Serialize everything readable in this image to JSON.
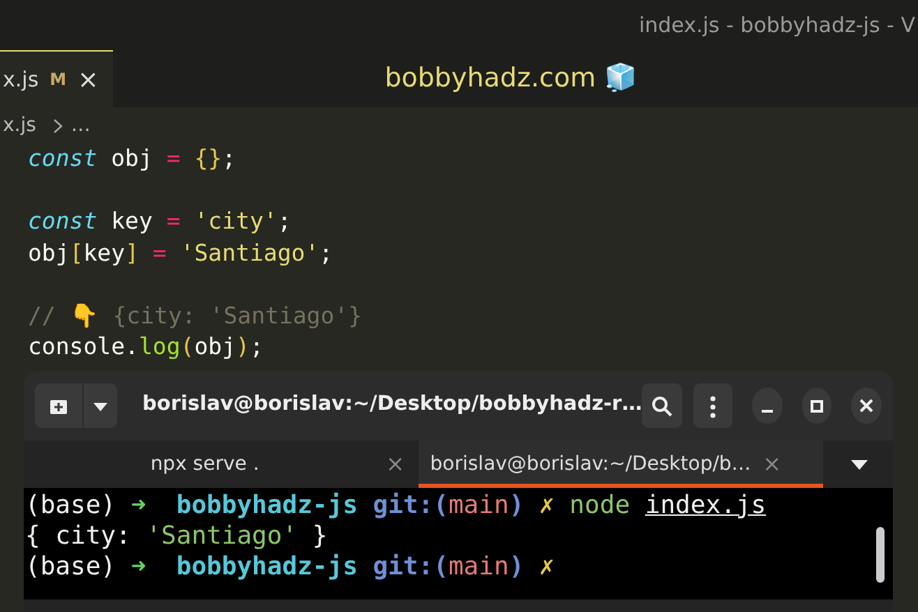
{
  "editor": {
    "title": "index.js - bobbyhadz-js - V",
    "tabs": [
      {
        "label": "x.js",
        "badge": "M",
        "close": "×",
        "selected": true
      }
    ],
    "banner": "bobbyhadz.com 🧊",
    "breadcrumb": [
      {
        "text": "x.js"
      },
      {
        "text": "…"
      }
    ],
    "code_lines": [
      {
        "blank_before": false,
        "tokens": [
          {
            "kind": "keyword",
            "text": "const"
          },
          {
            "kind": "plain",
            "text": " obj "
          },
          {
            "kind": "op",
            "text": "="
          },
          {
            "kind": "bracket",
            "text": " {}"
          },
          {
            "kind": "plain",
            "text": ";"
          }
        ]
      },
      {
        "blank_before": true,
        "tokens": [
          {
            "kind": "keyword",
            "text": "const"
          },
          {
            "kind": "plain",
            "text": " key "
          },
          {
            "kind": "op",
            "text": "="
          },
          {
            "kind": "string",
            "text": " 'city'"
          },
          {
            "kind": "plain",
            "text": ";"
          }
        ]
      },
      {
        "blank_before": false,
        "tokens": [
          {
            "kind": "plain",
            "text": "obj"
          },
          {
            "kind": "bracket",
            "text": "["
          },
          {
            "kind": "plain",
            "text": "key"
          },
          {
            "kind": "bracket",
            "text": "]"
          },
          {
            "kind": "op",
            "text": " ="
          },
          {
            "kind": "string",
            "text": " 'Santiago'"
          },
          {
            "kind": "plain",
            "text": ";"
          }
        ]
      },
      {
        "blank_before": true,
        "tokens": [
          {
            "kind": "comment",
            "text": "// 👇 {city: 'Santiago'}"
          }
        ]
      },
      {
        "blank_before": false,
        "tokens": [
          {
            "kind": "plain",
            "text": "console."
          },
          {
            "kind": "func",
            "text": "log"
          },
          {
            "kind": "bracket",
            "text": "("
          },
          {
            "kind": "plain",
            "text": "obj"
          },
          {
            "kind": "bracket",
            "text": ")"
          },
          {
            "kind": "plain",
            "text": ";"
          }
        ]
      }
    ]
  },
  "terminal": {
    "title": "borislav@borislav:~/Desktop/bobbyhadz-r…",
    "tabs": [
      {
        "label": "npx serve .",
        "close": "×",
        "selected": false
      },
      {
        "label": "borislav@borislav:~/Desktop/b…",
        "close": "×",
        "selected": true
      }
    ],
    "output_lines": [
      {
        "tokens": [
          {
            "kind": "plain",
            "text": "(base) "
          },
          {
            "kind": "arrow",
            "text": "➜"
          },
          {
            "kind": "dir",
            "text": "  bobbyhadz-js"
          },
          {
            "kind": "git",
            "text": " git:("
          },
          {
            "kind": "branch",
            "text": "main"
          },
          {
            "kind": "git",
            "text": ")"
          },
          {
            "kind": "dirty",
            "text": " ✗"
          },
          {
            "kind": "cmd",
            "text": " node "
          },
          {
            "kind": "path",
            "text": "index.js"
          }
        ]
      },
      {
        "tokens": [
          {
            "kind": "plain",
            "text": "{ city: "
          },
          {
            "kind": "cmd",
            "text": "'Santiago'"
          },
          {
            "kind": "plain",
            "text": " }"
          }
        ]
      },
      {
        "tokens": [
          {
            "kind": "plain",
            "text": "(base) "
          },
          {
            "kind": "arrow",
            "text": "➜"
          },
          {
            "kind": "dir",
            "text": "  bobbyhadz-js"
          },
          {
            "kind": "git",
            "text": " git:("
          },
          {
            "kind": "branch",
            "text": "main"
          },
          {
            "kind": "git",
            "text": ")"
          },
          {
            "kind": "dirty",
            "text": " ✗"
          }
        ]
      }
    ]
  }
}
